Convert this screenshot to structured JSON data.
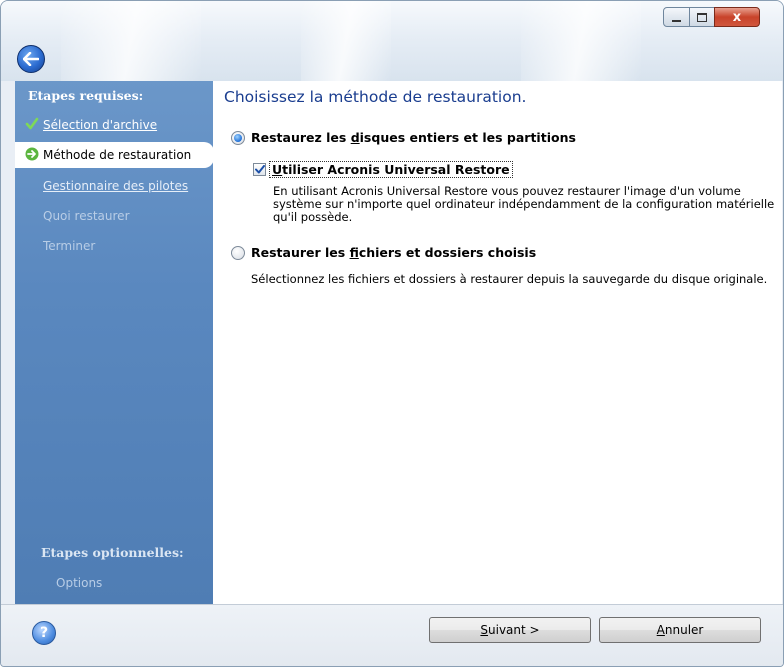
{
  "window": {
    "minimize_icon": "minimize-icon",
    "maximize_icon": "maximize-icon",
    "close_glyph": "x",
    "back_icon": "back-arrow-icon"
  },
  "sidebar": {
    "required_heading": "Etapes requises:",
    "steps": [
      {
        "label": "Sélection d'archive",
        "state": "done",
        "icon": "check-icon"
      },
      {
        "label": "Méthode de restauration",
        "state": "active",
        "icon": "arrow-right-icon"
      },
      {
        "label": "Gestionnaire des pilotes",
        "state": "link"
      },
      {
        "label": "Quoi restaurer",
        "state": "disabled"
      },
      {
        "label": "Terminer",
        "state": "disabled"
      }
    ],
    "optional_heading": "Etapes optionnelles:",
    "optional_steps": [
      {
        "label": "Options",
        "state": "disabled"
      }
    ]
  },
  "main": {
    "title": "Choisissez la méthode de restauration.",
    "option1": {
      "label_before": "Restaurez les ",
      "label_access": "d",
      "label_after": "isques entiers et les partitions",
      "selected": true
    },
    "universal_restore": {
      "label_access": "U",
      "label_after": "tiliser Acronis Universal Restore",
      "checked": true,
      "description_line1": "En utilisant Acronis Universal Restore vous pouvez restaurer l'image d'un volume",
      "description_line2": "système sur n'importe quel ordinateur indépendamment de la configuration matérielle",
      "description_line3": "qu'il possède."
    },
    "option2": {
      "label_before": "Restaurer les ",
      "label_access": "f",
      "label_after": "ichiers et dossiers choisis",
      "selected": false,
      "description": "Sélectionnez les fichiers et dossiers à restaurer depuis la sauvegarde du disque originale."
    }
  },
  "footer": {
    "help_glyph": "?",
    "next_access": "S",
    "next_rest": "uivant >",
    "cancel_access": "A",
    "cancel_rest": "nnuler"
  },
  "colors": {
    "sidebar": "#5a88bf",
    "title": "#1a3d8f"
  }
}
